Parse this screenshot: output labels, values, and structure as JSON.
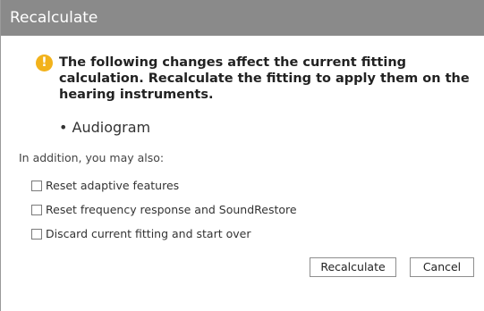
{
  "dialog": {
    "title": "Recalculate",
    "notice": {
      "icon": "warning-icon",
      "icon_glyph": "!",
      "icon_color": "#f2b21b",
      "text": "The following changes affect the current fitting calculation. Recalculate the fitting to apply them on the hearing instruments."
    },
    "changes": [
      "• Audiogram"
    ],
    "addition_label": "In addition, you may also:",
    "options": [
      {
        "label": "Reset adaptive features",
        "checked": false
      },
      {
        "label": "Reset frequency response and SoundRestore",
        "checked": false
      },
      {
        "label": "Discard current fitting and start over",
        "checked": false
      }
    ],
    "buttons": {
      "recalculate": "Recalculate",
      "cancel": "Cancel"
    },
    "colors": {
      "titlebar": "#8a8a8a",
      "warning": "#f2b21b"
    }
  }
}
